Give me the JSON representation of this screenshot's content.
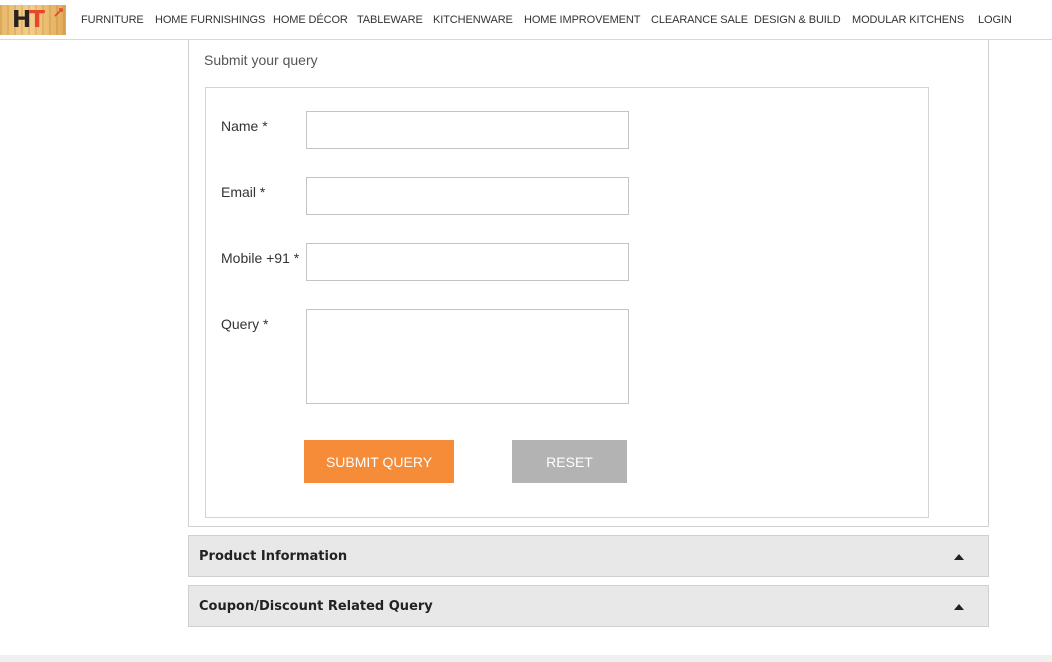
{
  "brand": {
    "logo_text_h": "H",
    "logo_text_t": "T"
  },
  "nav": {
    "items": [
      {
        "label": "FURNITURE",
        "name": "nav-item-furniture"
      },
      {
        "label": "HOME FURNISHINGS",
        "name": "nav-item-home-furnishings"
      },
      {
        "label": "HOME DÉCOR",
        "name": "nav-item-home-decor"
      },
      {
        "label": "TABLEWARE",
        "name": "nav-item-tableware"
      },
      {
        "label": "KITCHENWARE",
        "name": "nav-item-kitchenware"
      },
      {
        "label": "HOME IMPROVEMENT",
        "name": "nav-item-home-improvement"
      },
      {
        "label": "CLEARANCE SALE",
        "name": "nav-item-clearance-sale"
      },
      {
        "label": "DESIGN & BUILD",
        "name": "nav-item-design-build"
      },
      {
        "label": "MODULAR KITCHENS",
        "name": "nav-item-modular-kitchens"
      },
      {
        "label": "LOGIN",
        "name": "nav-item-login"
      }
    ]
  },
  "form": {
    "title": "Submit your query",
    "name_label": "Name *",
    "name_value": "",
    "email_label": "Email *",
    "email_value": "",
    "mobile_label": "Mobile +91 *",
    "mobile_value": "",
    "query_label": "Query *",
    "query_value": "",
    "submit_label": "SUBMIT QUERY",
    "reset_label": "RESET"
  },
  "accordions": {
    "product_info": "Product Information",
    "coupon": "Coupon/Discount Related Query"
  },
  "colors": {
    "accent": "#f68b38",
    "reset": "#b3b3b3",
    "accordion_bg": "#e8e8e8"
  }
}
